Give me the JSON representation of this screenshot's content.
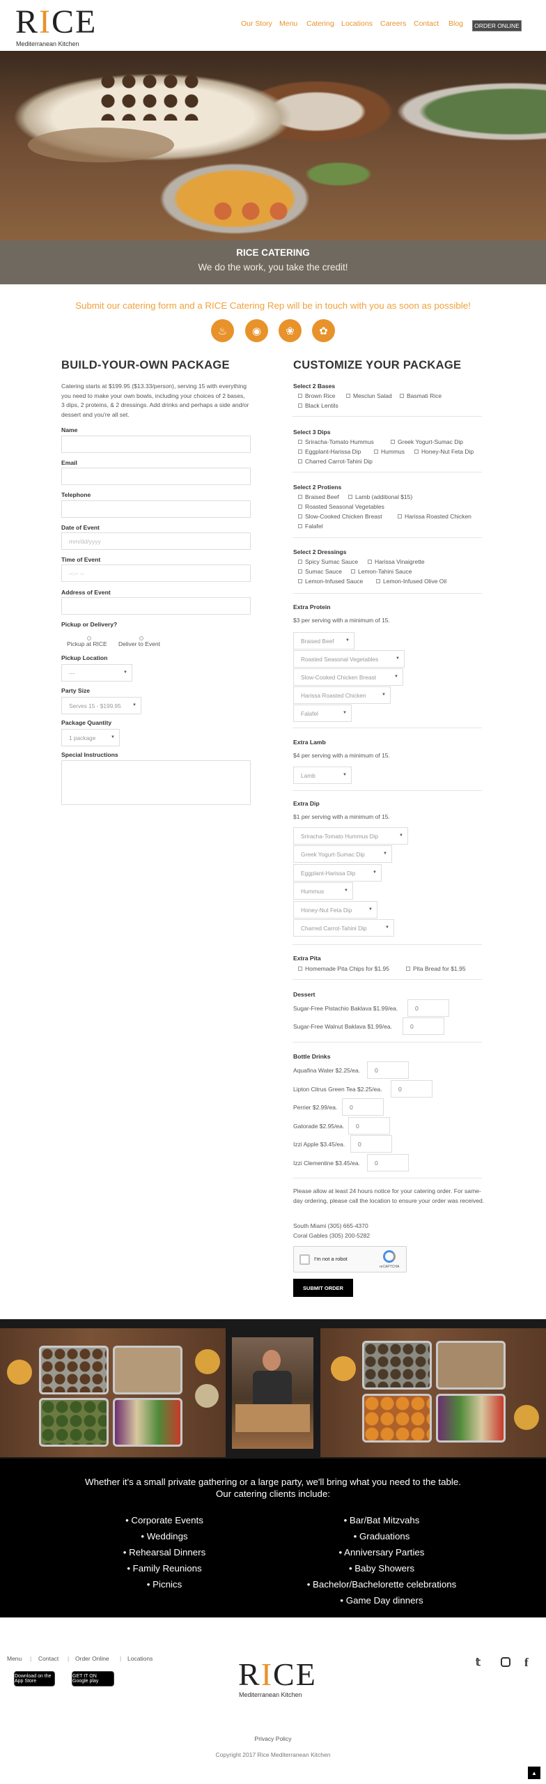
{
  "brand": {
    "logo_text": "RICE",
    "tagline": "Mediterranean Kitchen",
    "accent_color": "#e8922b"
  },
  "nav": {
    "items": [
      "Our Story",
      "Menu",
      "Catering",
      "Locations",
      "Careers",
      "Contact",
      "Blog"
    ],
    "cta": "ORDER ONLINE"
  },
  "hero": {
    "title": "RICE CATERING",
    "subtitle": "We do the work, you take the credit!"
  },
  "intro": "Submit our catering form and a RICE Catering Rep will be in touch with you as soon as possible!",
  "icons": [
    "flame-icon",
    "bowl-icon",
    "leaf-icon",
    "pita-icon"
  ],
  "build": {
    "title": "BUILD-YOUR-OWN PACKAGE",
    "description": "Catering starts at $199.95 ($13.33/person), serving 15 with everything you need to make your own bowls, including your choices of 2 bases, 3 dips, 2 proteins, & 2 dressings. Add drinks and perhaps a side and/or dessert and you're all set.",
    "fields": {
      "name": "Name",
      "email": "Email",
      "telephone": "Telephone",
      "date": "Date of Event",
      "date_placeholder": "mm/dd/yyyy",
      "time": "Time of Event",
      "time_placeholder": "--:-- --",
      "address": "Address of Event",
      "pickup": "Pickup or Delivery?",
      "pickup_opt1": "Pickup at RICE",
      "pickup_opt2": "Deliver to Event",
      "location": "Pickup Location",
      "location_value": "---",
      "party": "Party Size",
      "party_value": "Serves 15 - $199.95",
      "qty": "Package Quantity",
      "qty_value": "1 package",
      "instructions": "Special Instructions"
    }
  },
  "customize": {
    "title": "CUSTOMIZE YOUR PACKAGE",
    "bases": {
      "label": "Select 2 Bases",
      "options": [
        "Brown Rice",
        "Mesclun Salad",
        "Basmati Rice",
        "Black Lentils"
      ]
    },
    "dips": {
      "label": "Select 3 Dips",
      "options": [
        "Sriracha-Tomato Hummus",
        "Greek Yogurt-Sumac Dip",
        "Eggplant-Harissa Dip",
        "Hummus",
        "Honey-Nut Feta Dip",
        "Charred Carrot-Tahini Dip"
      ]
    },
    "proteins": {
      "label": "Select 2 Protiens",
      "options": [
        "Braised Beef",
        "Lamb (additional $15)",
        "Roasted Seasonal Vegetables",
        "Slow-Cooked Chicken Breast",
        "Harissa Roasted Chicken",
        "Falafel"
      ]
    },
    "dressings": {
      "label": "Select 2 Dressings",
      "options": [
        "Spicy Sumac Sauce",
        "Harissa Vinaigrette",
        "Sumac Sauce",
        "Lemon-Tahini Sauce",
        "Lemon-Infused Sauce",
        "Lemon-Infused Olive Oil"
      ]
    },
    "extra_protein": {
      "label": "Extra Protein",
      "note": "$3 per serving with a minimum of 15.",
      "selects": [
        "Braised Beef",
        "Roasted Seasonal Vegetables",
        "Slow-Cooked Chicken Breast",
        "Harissa Roasted Chicken",
        "Falafel"
      ]
    },
    "extra_lamb": {
      "label": "Extra Lamb",
      "note": "$4 per serving with a minimum of 15.",
      "selects": [
        "Lamb"
      ]
    },
    "extra_dip": {
      "label": "Extra Dip",
      "note": "$1 per serving with a minimum of 15.",
      "selects": [
        "Sriracha-Tomato Hummus Dip",
        "Greek Yogurt-Sumac Dip",
        "Eggplant-Harissa Dip",
        "Hummus",
        "Honey-Nut Feta Dip",
        "Charred Carrot-Tahini Dip"
      ]
    },
    "extra_pita": {
      "label": "Extra Pita",
      "options": [
        "Homemade Pita Chips for $1.95",
        "Pita Bread for $1.95"
      ]
    },
    "dessert": {
      "label": "Dessert",
      "items": [
        {
          "name": "Sugar-Free Pistachio Baklava $1.99/ea.",
          "qty": "0"
        },
        {
          "name": "Sugar-Free Walnut Baklava $1.99/ea.",
          "qty": "0"
        }
      ]
    },
    "drinks": {
      "label": "Bottle Drinks",
      "items": [
        {
          "name": "Aquafina Water $2.25/ea.",
          "qty": "0"
        },
        {
          "name": "Lipton Citrus Green Tea $2.25/ea.",
          "qty": "0"
        },
        {
          "name": "Perrier $2.99/ea.",
          "qty": "0"
        },
        {
          "name": "Gatorade $2.95/ea.",
          "qty": "0"
        },
        {
          "name": "Izzi Apple $3.45/ea.",
          "qty": "0"
        },
        {
          "name": "Izzi Clementine $3.45/ea.",
          "qty": "0"
        }
      ]
    },
    "notice": "Please allow at least 24 hours notice for your catering order. For same-day ordering, please call the location to ensure your order was received.",
    "phone1": "South Miami (305) 665-4370",
    "phone2": "Coral Gables (305) 200-5282",
    "captcha": "I'm not a robot",
    "captcha_brand": "reCAPTCHA",
    "submit": "SUBMIT ORDER"
  },
  "clients": {
    "headline1": "Whether it's a small private gathering or a large party, we'll bring what you need to the table.",
    "headline2": "Our catering clients include:",
    "left": [
      "• Corporate Events",
      "• Weddings",
      "• Rehearsal Dinners",
      "• Family Reunions",
      "• Picnics"
    ],
    "right": [
      "• Bar/Bat Mitzvahs",
      "• Graduations",
      "• Anniversary Parties",
      "• Baby Showers",
      "• Bachelor/Bachelorette celebrations",
      "• Game Day dinners"
    ]
  },
  "footer": {
    "links": [
      "Menu",
      "Contact",
      "Order Online",
      "Locations"
    ],
    "sep": "|",
    "app_store": "Download on the App Store",
    "google_play": "GET IT ON Google play",
    "privacy": "Privacy Policy",
    "copyright": "Copyright 2017 Rice Mediterranean Kitchen",
    "social": [
      "twitter-icon",
      "instagram-icon",
      "facebook-icon"
    ]
  }
}
